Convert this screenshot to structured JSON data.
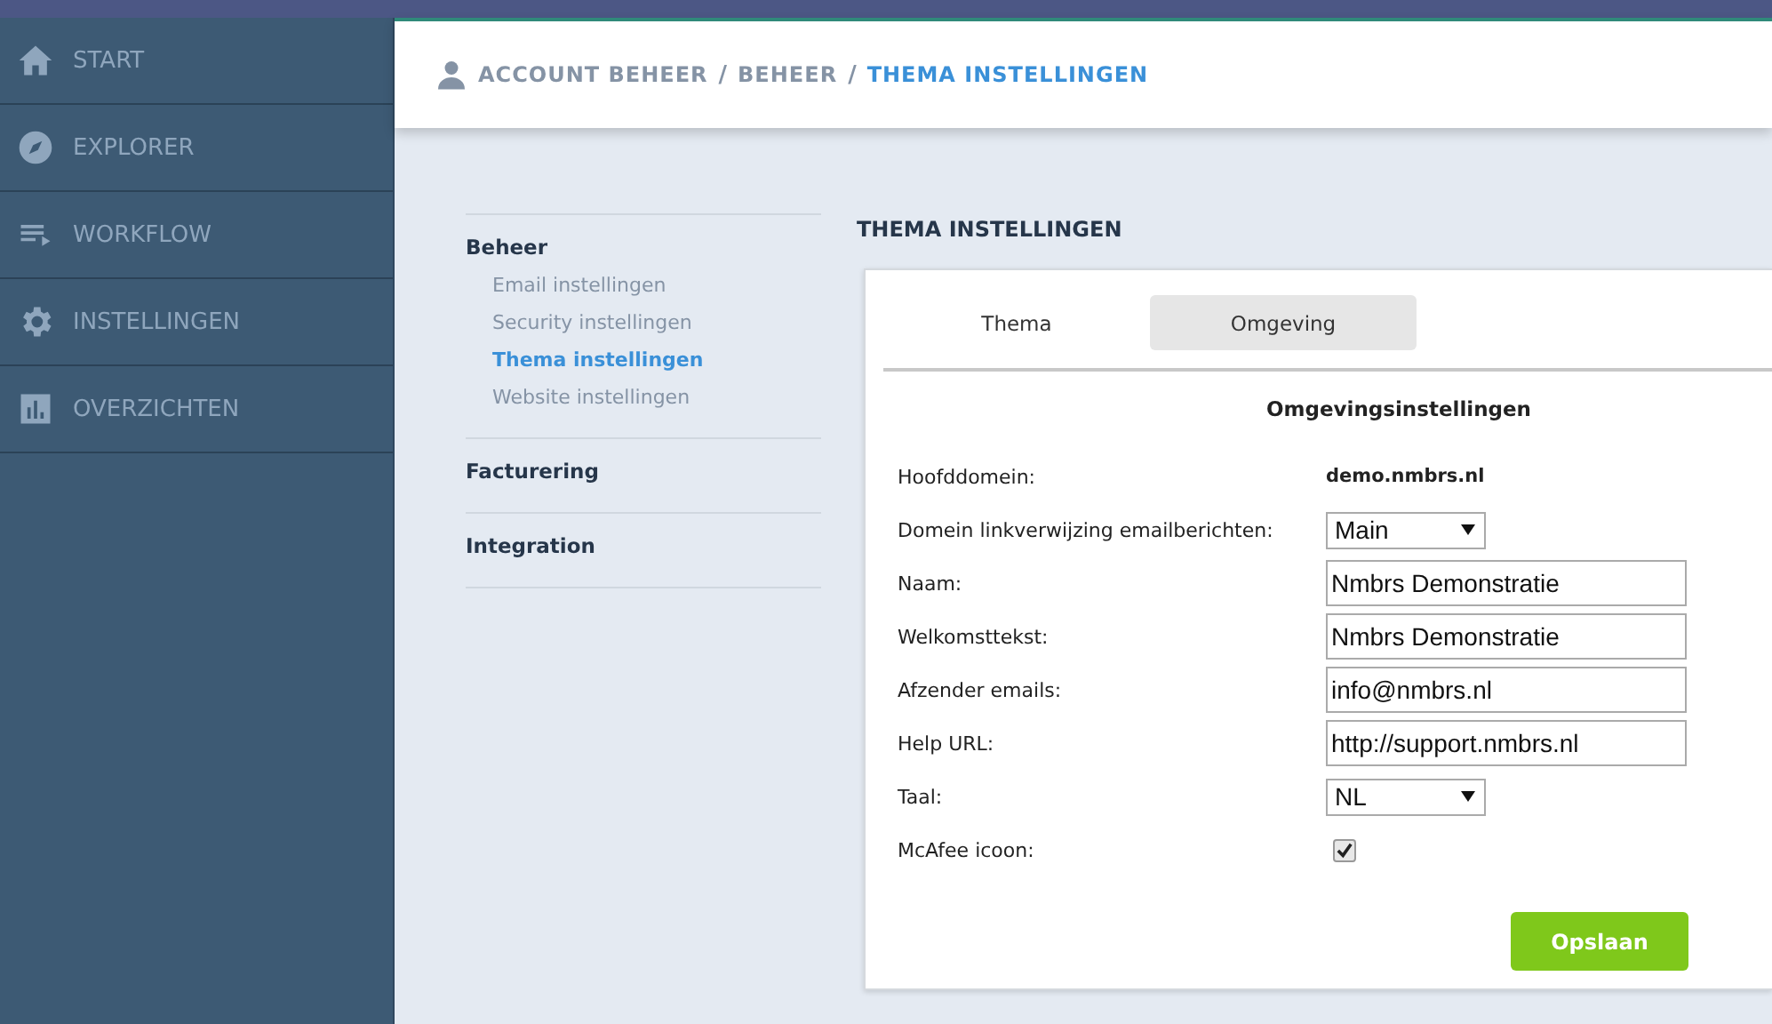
{
  "sidebar": {
    "items": [
      {
        "label": "START",
        "kind": "home"
      },
      {
        "label": "EXPLORER",
        "kind": "compass"
      },
      {
        "label": "WORKFLOW",
        "kind": "list"
      },
      {
        "label": "INSTELLINGEN",
        "kind": "gear"
      },
      {
        "label": "OVERZICHTEN",
        "kind": "chart"
      }
    ]
  },
  "breadcrumb": [
    {
      "label": "ACCOUNT BEHEER",
      "selected": false
    },
    {
      "label": "BEHEER",
      "selected": false
    },
    {
      "label": "THEMA INSTELLINGEN",
      "selected": true
    }
  ],
  "breadcrumb_separator": "/",
  "submenu": [
    {
      "label": "Beheer",
      "children": [
        {
          "label": "Email instellingen",
          "selected": false
        },
        {
          "label": "Security instellingen",
          "selected": false
        },
        {
          "label": "Thema instellingen",
          "selected": true
        },
        {
          "label": "Website instellingen",
          "selected": false
        }
      ]
    },
    {
      "label": "Facturering"
    },
    {
      "label": "Integration"
    }
  ],
  "section_title": "THEMA INSTELLINGEN",
  "tabs": [
    {
      "label": "Thema",
      "selected": false
    },
    {
      "label": "Omgeving",
      "selected": true
    }
  ],
  "form": {
    "title": "Omgevingsinstellingen",
    "rows": [
      {
        "kind": "text",
        "label": "Hoofddomein:",
        "value": "demo.nmbrs.nl"
      },
      {
        "kind": "select",
        "label": "Domein linkverwijzing emailberichten:",
        "value": "Main"
      },
      {
        "kind": "input",
        "label": "Naam:",
        "value": "Nmbrs Demonstratie"
      },
      {
        "kind": "input",
        "label": "Welkomsttekst:",
        "value": "Nmbrs Demonstratie"
      },
      {
        "kind": "input",
        "label": "Afzender emails:",
        "value": "info@nmbrs.nl"
      },
      {
        "kind": "input",
        "label": "Help URL:",
        "value": "http://support.nmbrs.nl"
      },
      {
        "kind": "select",
        "label": "Taal:",
        "value": "NL"
      },
      {
        "kind": "checkbox",
        "label": "McAfee icoon:",
        "checked": true
      }
    ],
    "save_button": "Opslaan"
  }
}
